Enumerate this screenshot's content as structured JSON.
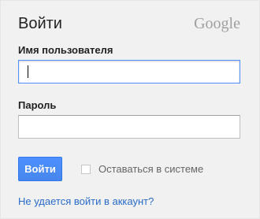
{
  "form": {
    "title": "Войти",
    "logo_text": "Google",
    "username_label": "Имя пользователя",
    "username_value": "",
    "password_label": "Пароль",
    "password_value": "",
    "submit_label": "Войти",
    "remember_label": "Оставаться в системе",
    "remember_checked": false,
    "help_link": "Не удается войти в аккаунт?"
  },
  "colors": {
    "button_blue": "#4d90fe",
    "focus_border": "#4d90fe",
    "link_blue": "#2a6bc9",
    "panel_bg": "#f1f1f1",
    "logo_gray": "#a0a0a0"
  }
}
